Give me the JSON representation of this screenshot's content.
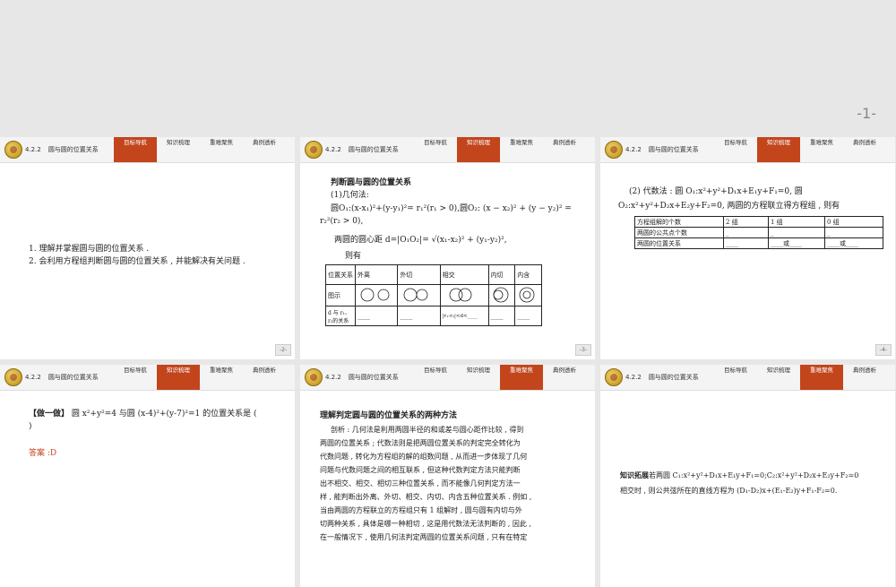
{
  "page_number": "-1-",
  "header": {
    "section": "4.2.2",
    "title": "圆与圆的位置关系",
    "tabs": [
      "目标导航",
      "知识梳理",
      "重难聚焦",
      "典例透析"
    ]
  },
  "slides": [
    {
      "active_tab": 0,
      "page": "-2-",
      "lines": [
        "1. 理解并掌握圆与圆的位置关系 .",
        "2. 会利用方程组判断圆与圆的位置关系 , 并能解决有关问题 ."
      ]
    },
    {
      "active_tab": 1,
      "page": "-3-",
      "title": "判断圆与圆的位置关系",
      "sub": "(1)几何法:",
      "circle_line": "圆O₁:(x-x₁)²+(y-y₁)²= r₁²(r₁ > 0),圆O₂: (x − x₂)² + (y − y₂)² =",
      "circle_line2": "r₂²(r₂ > 0),",
      "distance": "两圆的圆心距 d=|O₁O₂|= √(x₁-x₂)² + (y₁-y₂)²,",
      "then": "则有",
      "table_header": [
        "位置关系",
        "外离",
        "外切",
        "相交",
        "内切",
        "内含"
      ],
      "row_fig": "图示",
      "row_rel": "d 与 r₁、r₂的关系",
      "rel_values": [
        "____",
        "____",
        "|r₁-r₂|<d<____",
        "____",
        "____"
      ]
    },
    {
      "active_tab": 1,
      "page": "-4-",
      "line1": "(2) 代数法 : 圆 O₁:x²+y²+D₁x+E₁y+F₁=0, 圆",
      "line2": "O₂:x²+y²+D₂x+E₂y+F₂=0, 两圆的方程联立得方程组 , 则有",
      "table": [
        [
          "方程组解的个数",
          "2 组",
          "1 组",
          "0 组"
        ],
        [
          "两圆的公共点个数",
          "_",
          "_",
          "_"
        ],
        [
          "两圆的位置关系",
          "____",
          "____或____",
          "____或____"
        ]
      ]
    },
    {
      "active_tab": 1,
      "page": "",
      "q_label": "【做一做】",
      "q_text": " 圆 x²+y²=4 与圆 (x-4)²+(y-7)²=1 的位置关系是 (",
      "q_close": ")",
      "answer": "答案 :D"
    },
    {
      "active_tab": 2,
      "page": "",
      "title": "理解判定圆与圆的位置关系的两种方法",
      "lines": [
        "剖析 : 几何法是利用两圆半径的和或差与圆心距作比较 , 得到",
        "两圆的位置关系 ; 代数法则是把两圆位置关系的判定完全转化为",
        "代数问题 , 转化为方程组的解的组数问题 , 从而进一步体现了几何",
        "问题与代数问题之间的相互联系 , 但这种代数判定方法只能判断",
        "出不相交、相交、相切三种位置关系 , 而不能像几何判定方法一",
        "样 , 能判断出外离、外切、相交、内切、内含五种位置关系 . 例如 ,",
        "当由两圆的方程联立的方程组只有 1 组解时 , 圆与圆有内切与外",
        "切两种关系 , 具体是哪一种相切 , 这是用代数法无法判断的 , 因此 ,",
        "在一般情况下 , 使用几何法判定两圆的位置关系问题 , 只有在特定"
      ]
    },
    {
      "active_tab": 2,
      "page": "",
      "label": "知识拓展",
      "line1": "若两圆 C₁:x²+y²+D₁x+E₁y+F₁=0;C₂:x²+y²+D₂x+E₂y+F₂=0",
      "line2": "相交时 , 则公共弦所在的直线方程为 (D₁-D₂)x+(E₁-E₂)y+F₁-F₂=0."
    }
  ]
}
